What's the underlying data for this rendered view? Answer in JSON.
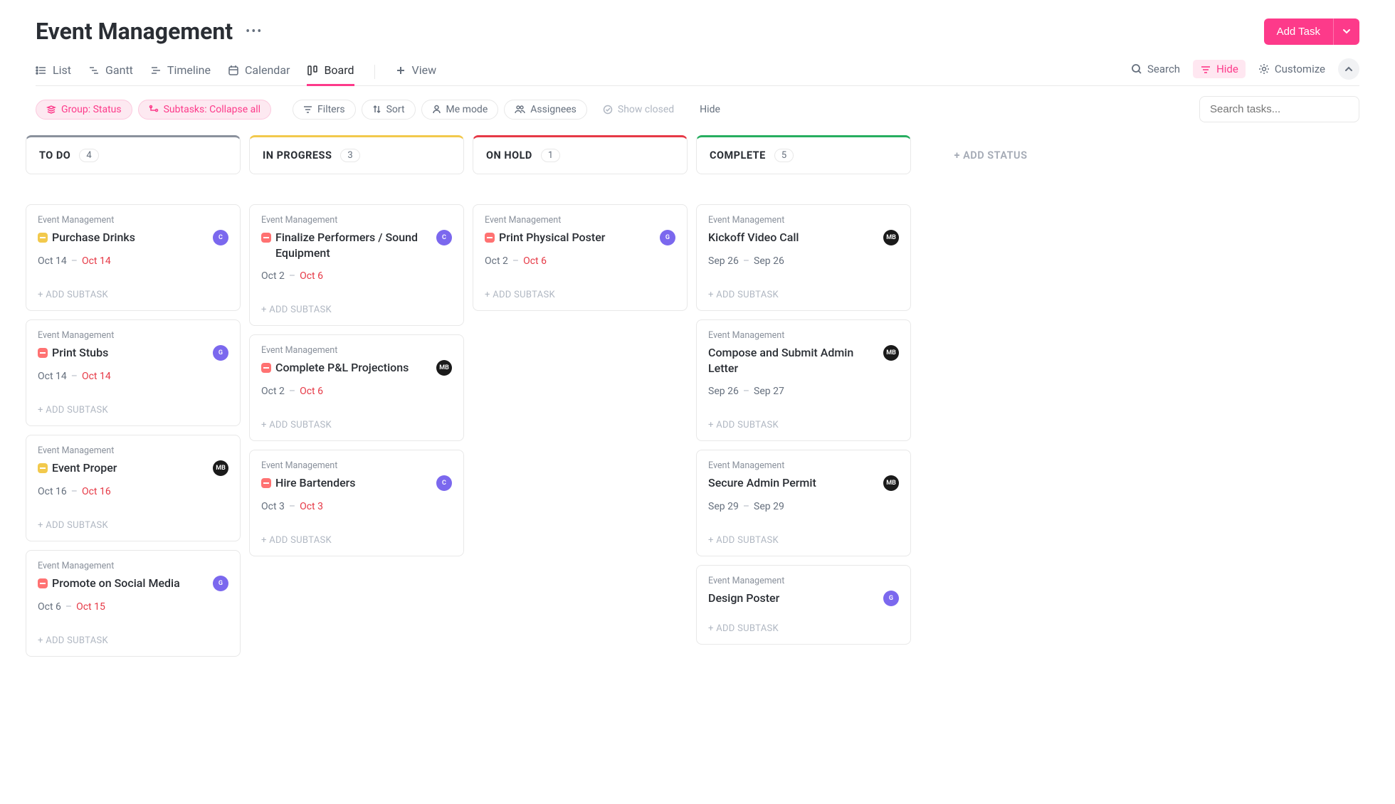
{
  "header": {
    "title": "Event Management",
    "add_task": "Add Task"
  },
  "tabs": {
    "list": "List",
    "gantt": "Gantt",
    "timeline": "Timeline",
    "calendar": "Calendar",
    "board": "Board",
    "view": "View"
  },
  "actions": {
    "search": "Search",
    "hide": "Hide",
    "customize": "Customize"
  },
  "filters": {
    "group": "Group: Status",
    "subtasks": "Subtasks: Collapse all",
    "filters": "Filters",
    "sort": "Sort",
    "me_mode": "Me mode",
    "assignees": "Assignees",
    "show_closed": "Show closed",
    "hide": "Hide",
    "search_placeholder": "Search tasks..."
  },
  "board": {
    "add_status": "+ ADD STATUS",
    "add_subtask": "+ ADD SUBTASK",
    "project_name": "Event Management",
    "columns": [
      {
        "title": "TO DO",
        "count": "4",
        "border_color": "#8a919c",
        "cards": [
          {
            "title": "Purchase Drinks",
            "priority_color": "#f2c94c",
            "start": "Oct 14",
            "end": "Oct 14",
            "end_red": true,
            "avatar": {
              "text": "C",
              "bg": "#7b68ee"
            }
          },
          {
            "title": "Print Stubs",
            "priority_color": "#ff7272",
            "start": "Oct 14",
            "end": "Oct 14",
            "end_red": true,
            "avatar": {
              "text": "G",
              "bg": "#7b68ee"
            }
          },
          {
            "title": "Event Proper",
            "priority_color": "#f2c94c",
            "start": "Oct 16",
            "end": "Oct 16",
            "end_red": true,
            "avatar": {
              "text": "MB",
              "bg": "#1a1a1a"
            }
          },
          {
            "title": "Promote on Social Media",
            "priority_color": "#ff7272",
            "start": "Oct 6",
            "end": "Oct 15",
            "end_red": true,
            "avatar": {
              "text": "G",
              "bg": "#7b68ee"
            }
          }
        ]
      },
      {
        "title": "IN PROGRESS",
        "count": "3",
        "border_color": "#f2c94c",
        "cards": [
          {
            "title": "Finalize Performers / Sound Equipment",
            "priority_color": "#ff7272",
            "start": "Oct 2",
            "end": "Oct 6",
            "end_red": true,
            "avatar": {
              "text": "C",
              "bg": "#7b68ee"
            }
          },
          {
            "title": "Complete P&L Projections",
            "priority_color": "#ff7272",
            "start": "Oct 2",
            "end": "Oct 6",
            "end_red": true,
            "avatar": {
              "text": "MB",
              "bg": "#1a1a1a"
            }
          },
          {
            "title": "Hire Bartenders",
            "priority_color": "#ff7272",
            "start": "Oct 3",
            "end": "Oct 3",
            "end_red": true,
            "avatar": {
              "text": "C",
              "bg": "#7b68ee"
            }
          }
        ]
      },
      {
        "title": "ON HOLD",
        "count": "1",
        "border_color": "#e63946",
        "cards": [
          {
            "title": "Print Physical Poster",
            "priority_color": "#ff7272",
            "start": "Oct 2",
            "end": "Oct 6",
            "end_red": true,
            "avatar": {
              "text": "G",
              "bg": "#7b68ee"
            }
          }
        ]
      },
      {
        "title": "COMPLETE",
        "count": "5",
        "border_color": "#27ae60",
        "cards": [
          {
            "title": "Kickoff Video Call",
            "priority_color": "",
            "start": "Sep 26",
            "end": "Sep 26",
            "end_red": false,
            "avatar": {
              "text": "MB",
              "bg": "#1a1a1a"
            }
          },
          {
            "title": "Compose and Submit Admin Letter",
            "priority_color": "",
            "start": "Sep 26",
            "end": "Sep 27",
            "end_red": false,
            "avatar": {
              "text": "MB",
              "bg": "#1a1a1a"
            }
          },
          {
            "title": "Secure Admin Permit",
            "priority_color": "",
            "start": "Sep 29",
            "end": "Sep 29",
            "end_red": false,
            "avatar": {
              "text": "MB",
              "bg": "#1a1a1a"
            }
          },
          {
            "title": "Design Poster",
            "priority_color": "",
            "start": "",
            "end": "",
            "end_red": false,
            "avatar": {
              "text": "G",
              "bg": "#7b68ee"
            }
          }
        ]
      }
    ]
  }
}
